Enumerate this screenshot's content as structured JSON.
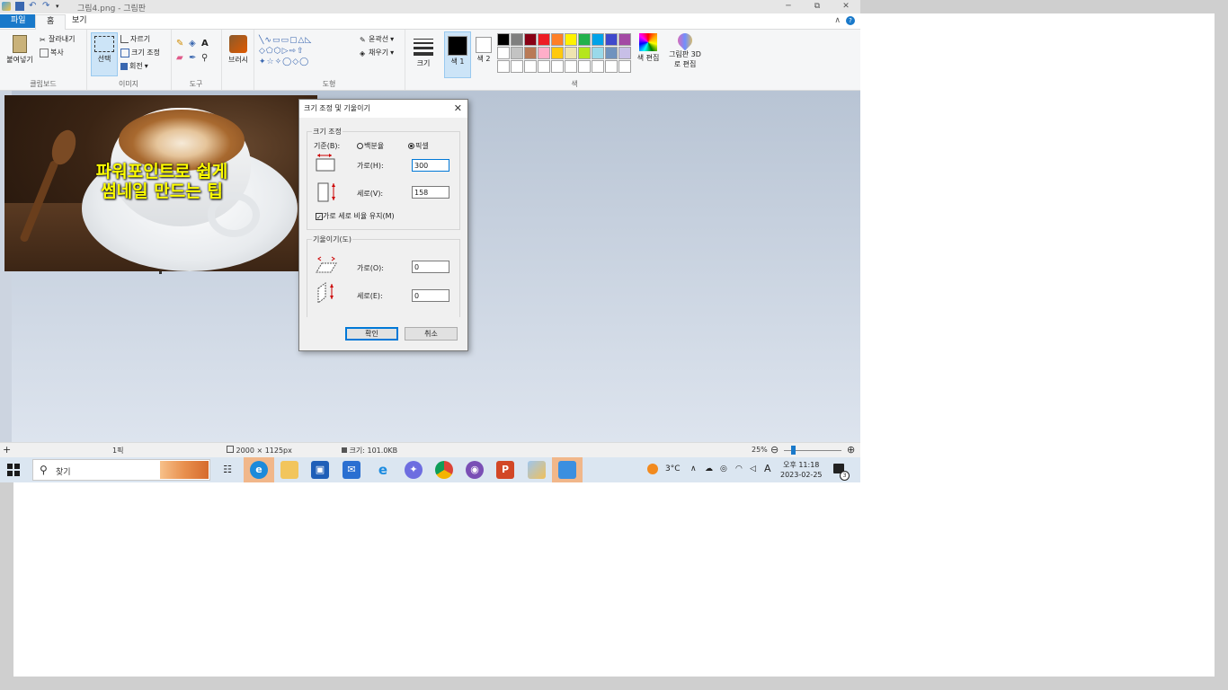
{
  "window": {
    "title": "그림4.png - 그림판",
    "minimize": "─",
    "maximize": "⧉",
    "close": "✕"
  },
  "ribbon_tabs": {
    "file": "파일",
    "home": "홈",
    "view": "보기"
  },
  "ribbon": {
    "clipboard": {
      "paste": "붙여넣기",
      "cut": "잘라내기",
      "copy": "복사",
      "label": "클립보드"
    },
    "image": {
      "select": "선택",
      "crop": "자르기",
      "resize": "크기 조정",
      "rotate": "회전",
      "label": "이미지"
    },
    "tools": {
      "label": "도구"
    },
    "brushes": {
      "label": "브러시"
    },
    "shapes": {
      "outline": "윤곽선",
      "fill": "채우기",
      "label": "도형"
    },
    "size": {
      "label": "크기"
    },
    "colors": {
      "color1": "색 1",
      "color2": "색 2",
      "edit": "색 편집",
      "paint3d": "그림판 3D로 편집",
      "label": "색",
      "swatches": [
        "#000000",
        "#7f7f7f",
        "#880015",
        "#ed1c24",
        "#ff7f27",
        "#fff200",
        "#22b14c",
        "#00a2e8",
        "#3f48cc",
        "#a349a4",
        "#ffffff",
        "#c3c3c3",
        "#b97a57",
        "#ffaec9",
        "#ffc90e",
        "#efe4b0",
        "#b5e61d",
        "#99d9ea",
        "#7092be",
        "#c8bfe7",
        "#ffffff",
        "#ffffff",
        "#ffffff",
        "#ffffff",
        "#ffffff",
        "#ffffff",
        "#ffffff",
        "#ffffff",
        "#ffffff",
        "#ffffff"
      ]
    }
  },
  "canvas": {
    "caption_line1": "파워포인트로 쉽게",
    "caption_line2": "썸네일 만드는 팁"
  },
  "dialog": {
    "title": "크기 조정 및 기울이기",
    "close": "✕",
    "resize_legend": "크기 조정",
    "by_label": "기준(B):",
    "percent": "백분율",
    "pixels": "픽셀",
    "horizontal": "가로(H):",
    "vertical": "세로(V):",
    "horizontal_value": "300",
    "vertical_value": "158",
    "keep_ratio": "가로 세로 비율 유지(M)",
    "skew_legend": "기울이기(도)",
    "skew_horizontal": "가로(O):",
    "skew_vertical": "세로(E):",
    "skew_h_value": "0",
    "skew_v_value": "0",
    "ok": "확인",
    "cancel": "취소"
  },
  "statusbar": {
    "add": "+",
    "selection": "1픽",
    "image_size": "2000 × 1125px",
    "file_size": "크기: 101.0KB",
    "zoom": "25%",
    "zoom_out": "⊖",
    "zoom_in": "⊕"
  },
  "taskbar": {
    "search": "찾기",
    "weather": "3°C",
    "ime": "A",
    "time": "오후 11:18",
    "date": "2023-02-25",
    "notifications": "3"
  }
}
